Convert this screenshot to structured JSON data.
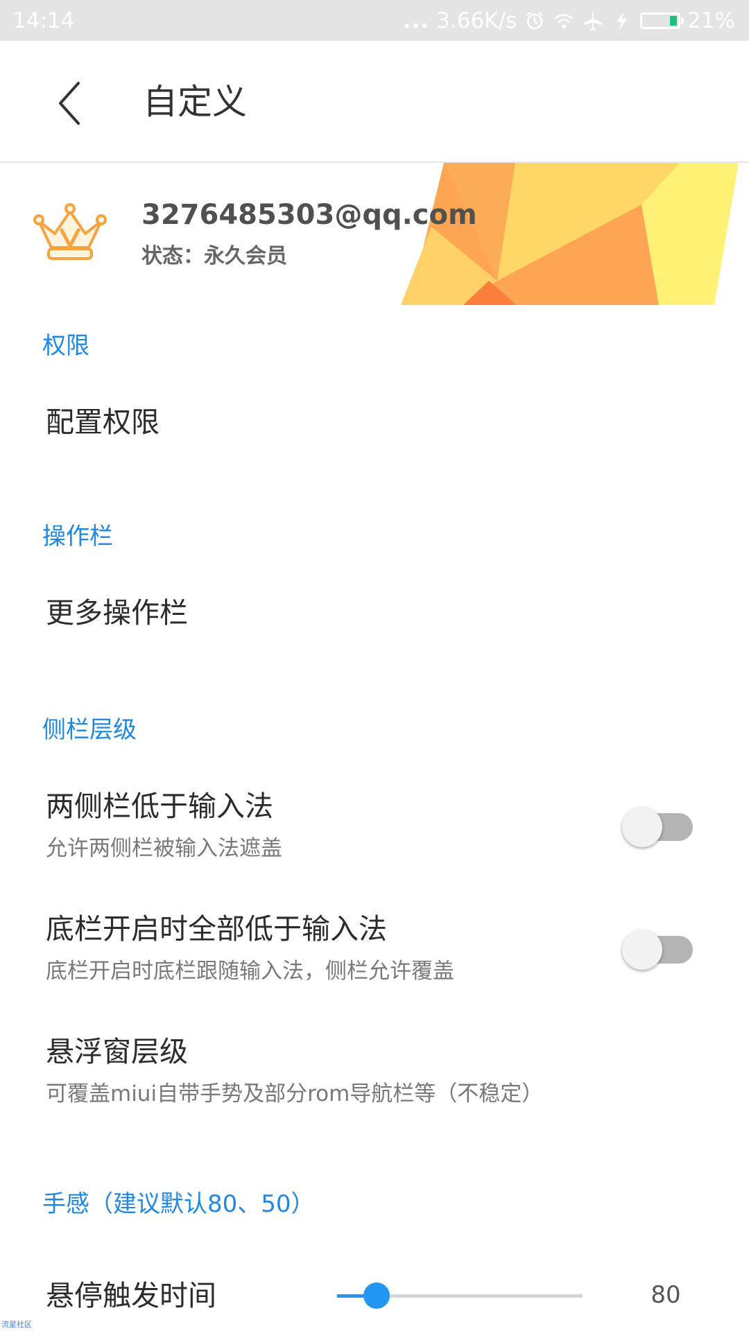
{
  "status_bar": {
    "time": "14:14",
    "dots": "...",
    "net_speed": "3.66K/s",
    "battery": "21%",
    "battery_fraction": 0.21,
    "battery_color": "#19c37d",
    "icons": [
      "alarm-icon",
      "wifi-icon",
      "airplane-mode-icon",
      "charging-icon",
      "battery-icon"
    ]
  },
  "app_bar": {
    "back_icon": "back-arrow-icon",
    "title": "自定义"
  },
  "account": {
    "email": "3276485303@qq.com",
    "status": "状态：永久会员",
    "badge_icon": "crown-icon"
  },
  "sections": {
    "permissions": {
      "header": "权限",
      "item_title": "配置权限"
    },
    "action_bar": {
      "header": "操作栏",
      "item_title": "更多操作栏"
    },
    "sidebar_level": {
      "header": "侧栏层级",
      "items": [
        {
          "title": "两侧栏低于输入法",
          "summary": "允许两侧栏被输入法遮盖",
          "enabled": false
        },
        {
          "title": "底栏开启时全部低于输入法",
          "summary": "底栏开启时底栏跟随输入法，侧栏允许覆盖",
          "enabled": false
        },
        {
          "title": "悬浮窗层级",
          "summary": "可覆盖miui自带手势及部分rom导航栏等（不稳定）"
        }
      ]
    },
    "feel": {
      "header": "手感（建议默认80、50）",
      "hover_time": {
        "label": "悬停触发时间",
        "value": "80",
        "slider_fraction": 0.16
      }
    }
  },
  "watermark": "流星社区",
  "colors": {
    "accent": "#1e88e5",
    "slider": "#2196f3",
    "status_bar_bg": "#e4e4e4"
  }
}
